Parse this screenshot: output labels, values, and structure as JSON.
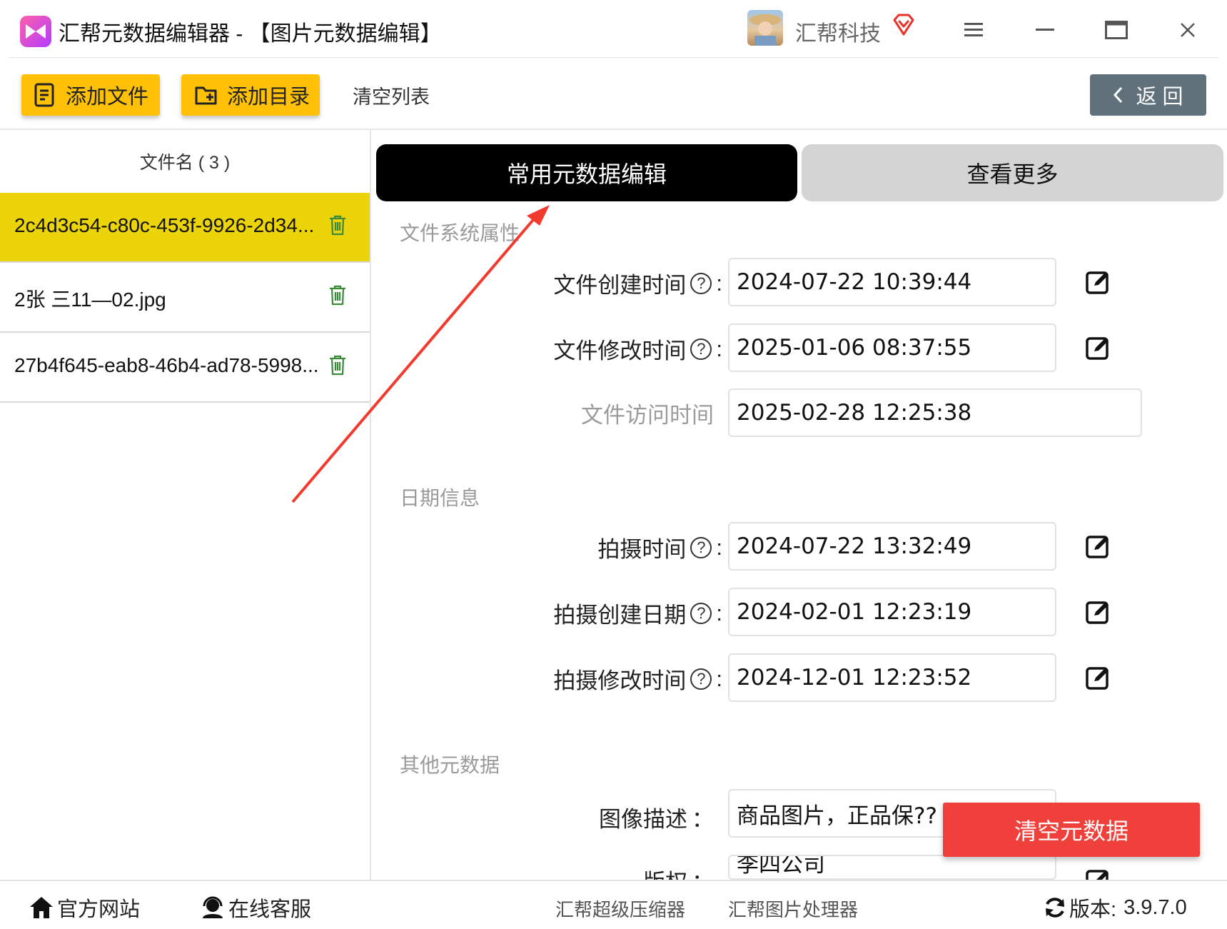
{
  "window": {
    "title": "汇帮元数据编辑器 - 【图片元数据编辑】",
    "company": "汇帮科技"
  },
  "toolbar": {
    "add_file": "添加文件",
    "add_folder": "添加目录",
    "clear_list": "清空列表",
    "back": "返 回"
  },
  "file_list": {
    "header": "文件名 ( 3 )",
    "items": [
      {
        "name": "2c4d3c54-c80c-453f-9926-2d34...",
        "selected": true
      },
      {
        "name": "2张 三11—02.jpg",
        "selected": false
      },
      {
        "name": "27b4f645-eab8-46b4-ad78-5998...",
        "selected": false
      }
    ]
  },
  "tabs": {
    "common": "常用元数据编辑",
    "more": "查看更多"
  },
  "sections": {
    "filesystem": "文件系统属性",
    "date": "日期信息",
    "other": "其他元数据"
  },
  "fields": {
    "created": {
      "label": "文件创建时间",
      "value": "2024-07-22 10:39:44"
    },
    "modified": {
      "label": "文件修改时间",
      "value": "2025-01-06 08:37:55"
    },
    "accessed": {
      "label": "文件访问时间",
      "value": "2025-02-28 12:25:38"
    },
    "shot_time": {
      "label": "拍摄时间",
      "value": "2024-07-22 13:32:49"
    },
    "shot_created": {
      "label": "拍摄创建日期",
      "value": "2024-02-01 12:23:19"
    },
    "shot_modified": {
      "label": "拍摄修改时间",
      "value": "2024-12-01 12:23:52"
    },
    "description": {
      "label": "图像描述",
      "value": "商品图片，正品保??"
    },
    "copyright": {
      "label": "版权",
      "value": "李四公司"
    }
  },
  "actions": {
    "clear_metadata": "清空元数据"
  },
  "statusbar": {
    "website": "官方网站",
    "support": "在线客服",
    "compressor": "汇帮超级压缩器",
    "image_processor": "汇帮图片处理器",
    "version_label": "版本:",
    "version": "3.9.7.0"
  },
  "colors": {
    "accent_yellow": "#ffc107",
    "selected_row": "#ecd40a",
    "danger_red": "#f0403b",
    "back_button": "#60717b",
    "annotation_arrow": "#f23a2f"
  }
}
